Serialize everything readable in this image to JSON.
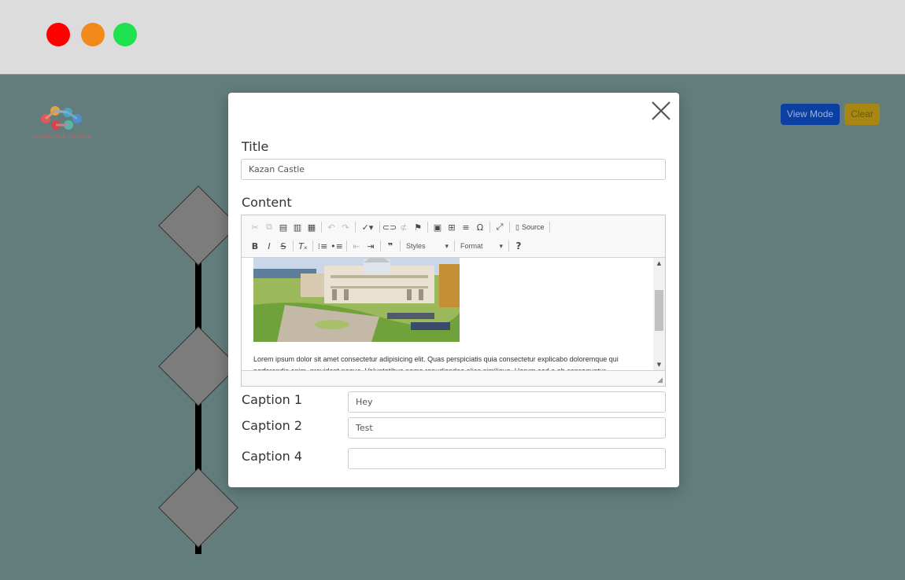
{
  "window": {
    "controls": [
      {
        "name": "close",
        "color": "#ff0000"
      },
      {
        "name": "minimize",
        "color": "#f18a1b"
      },
      {
        "name": "maximize",
        "color": "#1ee34f"
      }
    ]
  },
  "header": {
    "logo_text": "knowledge explorer",
    "view_mode_label": "View Mode",
    "clear_label": "Clear"
  },
  "modal": {
    "title_label": "Title",
    "title_value": "Kazan Castle",
    "content_label": "Content",
    "editor": {
      "source_label": "Source",
      "styles_label": "Styles",
      "format_label": "Format",
      "body_text": "Lorem ipsum dolor sit amet consectetur adipisicing elit. Quas perspiciatis quia consectetur explicabo doloremque qui perferendis enim, provident neque. Voluptatibus nemo repudiandae alias similique. Harum sed a ab consequatur."
    },
    "captions": [
      {
        "label": "Caption 1",
        "value": "Hey"
      },
      {
        "label": "Caption 2",
        "value": "Test"
      },
      {
        "label": "Caption 4",
        "value": ""
      }
    ]
  }
}
